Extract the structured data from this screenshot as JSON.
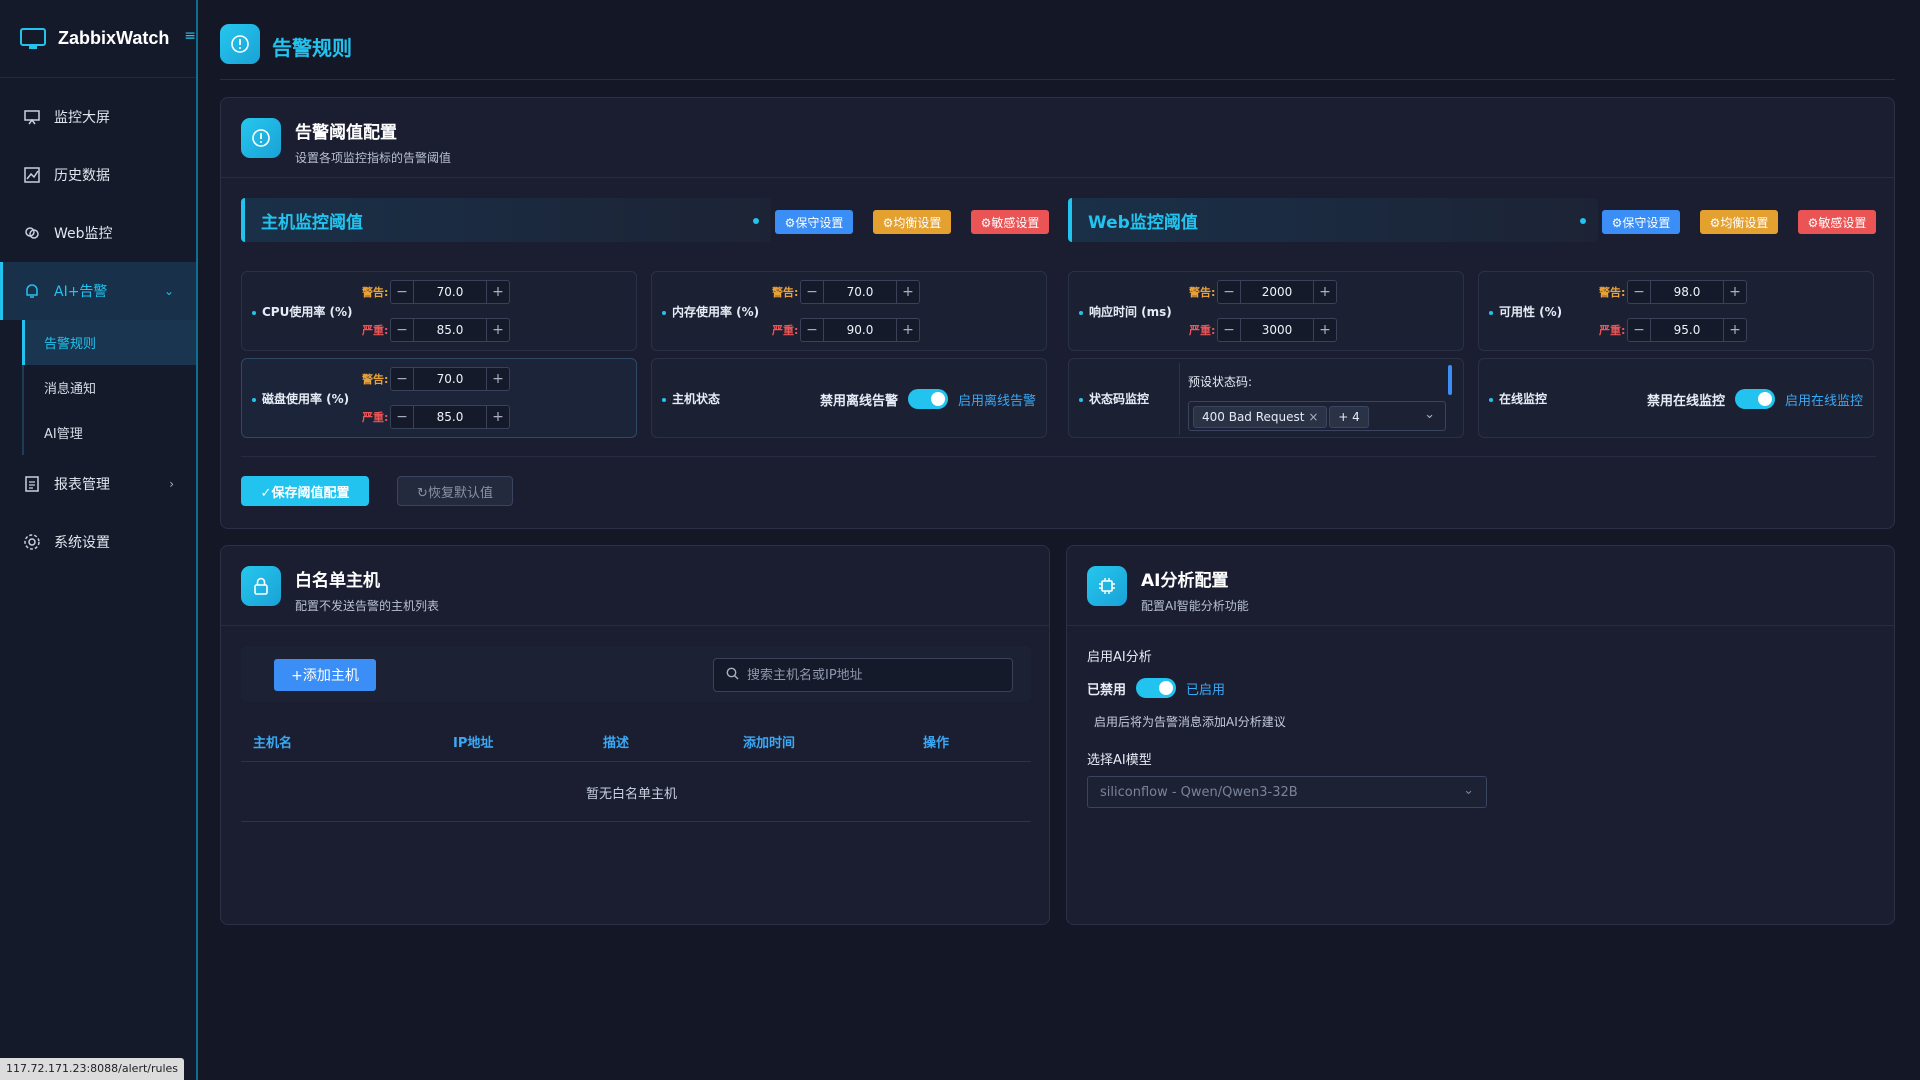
{
  "app": {
    "brand": "ZabbixWatch",
    "menu_glyph": "≡"
  },
  "sidebar": {
    "items": [
      {
        "label": "监控大屏"
      },
      {
        "label": "历史数据"
      },
      {
        "label": "Web监控"
      },
      {
        "label": "AI+告警"
      },
      {
        "label": "报表管理"
      },
      {
        "label": "系统设置"
      }
    ],
    "subitems": [
      {
        "label": "告警规则"
      },
      {
        "label": "消息通知"
      },
      {
        "label": "AI管理"
      }
    ]
  },
  "page": {
    "title": "告警规则"
  },
  "threshold": {
    "title": "告警阈值配置",
    "subtitle": "设置各项监控指标的告警阈值",
    "host_section": "主机监控阈值",
    "web_section": "Web监控阈值",
    "preset_conservative": "⚙保守设置",
    "preset_balanced": "⚙均衡设置",
    "preset_sensitive": "⚙敏感设置",
    "warn_label": "警告:",
    "crit_label": "严重:",
    "metrics": {
      "cpu": {
        "label": "CPU使用率 (%)",
        "warn": "70.0",
        "crit": "85.0"
      },
      "mem": {
        "label": "内存使用率 (%)",
        "warn": "70.0",
        "crit": "90.0"
      },
      "disk": {
        "label": "磁盘使用率 (%)",
        "warn": "70.0",
        "crit": "85.0"
      },
      "resp": {
        "label": "响应时间 (ms)",
        "warn": "2000",
        "crit": "3000"
      },
      "avail": {
        "label": "可用性 (%)",
        "warn": "98.0",
        "crit": "95.0"
      }
    },
    "host_status": {
      "label": "主机状态",
      "off": "禁用离线告警",
      "on": "启用离线告警"
    },
    "status_code": {
      "label": "状态码监控",
      "preset_label": "预设状态码:",
      "chip": "400 Bad Request",
      "more": "+ 4"
    },
    "online": {
      "label": "在线监控",
      "off": "禁用在线监控",
      "on": "启用在线监控"
    },
    "save": "✓保存阈值配置",
    "reset": "↻恢复默认值"
  },
  "whitelist": {
    "title": "白名单主机",
    "subtitle": "配置不发送告警的主机列表",
    "add": "+添加主机",
    "search_placeholder": "搜索主机名或IP地址",
    "columns": [
      "主机名",
      "IP地址",
      "描述",
      "添加时间",
      "操作"
    ],
    "empty": "暂无白名单主机"
  },
  "ai": {
    "title": "AI分析配置",
    "subtitle": "配置AI智能分析功能",
    "enable_label": "启用AI分析",
    "off": "已禁用",
    "on": "已启用",
    "hint": "启用后将为告警消息添加AI分析建议",
    "model_label": "选择AI模型",
    "model_value": "siliconflow - Qwen/Qwen3-32B"
  },
  "status_url": "117.72.171.23:8088/alert/rules",
  "colors": {
    "accent": "#22c3ee",
    "warn": "#e8a23a",
    "crit": "#ea5455",
    "blue": "#3b8ef5"
  }
}
